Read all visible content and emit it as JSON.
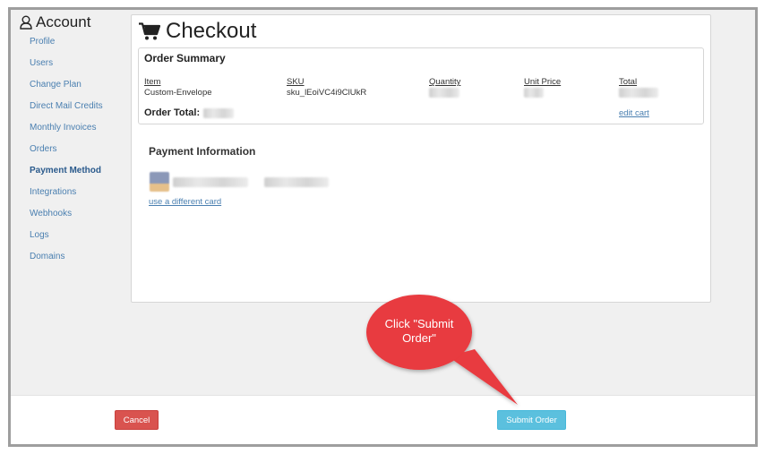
{
  "sidebar": {
    "title": "Account",
    "items": [
      {
        "label": "Profile"
      },
      {
        "label": "Users"
      },
      {
        "label": "Change Plan"
      },
      {
        "label": "Direct Mail Credits"
      },
      {
        "label": "Monthly Invoices"
      },
      {
        "label": "Orders"
      },
      {
        "label": "Payment Method",
        "active": true
      },
      {
        "label": "Integrations"
      },
      {
        "label": "Webhooks"
      },
      {
        "label": "Logs"
      },
      {
        "label": "Domains"
      }
    ]
  },
  "checkout": {
    "title": "Checkout",
    "icon": "cart-icon"
  },
  "order_summary": {
    "title": "Order Summary",
    "headers": {
      "item": "Item",
      "sku": "SKU",
      "quantity": "Quantity",
      "unit_price": "Unit Price",
      "total": "Total"
    },
    "row": {
      "item": "Custom-Envelope",
      "sku": "sku_lEoiVC4i9ClUkR"
    },
    "order_total_label": "Order Total:",
    "edit_cart": "edit cart"
  },
  "payment": {
    "title": "Payment Information",
    "card_icon": "credit-card-icon",
    "use_different_card": "use a different card"
  },
  "footer": {
    "cancel_label": "Cancel",
    "submit_label": "Submit Order"
  },
  "callout": {
    "text_line1": "Click \"Submit",
    "text_line2": "Order\"",
    "color": "#e83a3f"
  },
  "colors": {
    "link": "#4a7fb0",
    "cancel": "#d9534f",
    "submit": "#5bc0de"
  }
}
